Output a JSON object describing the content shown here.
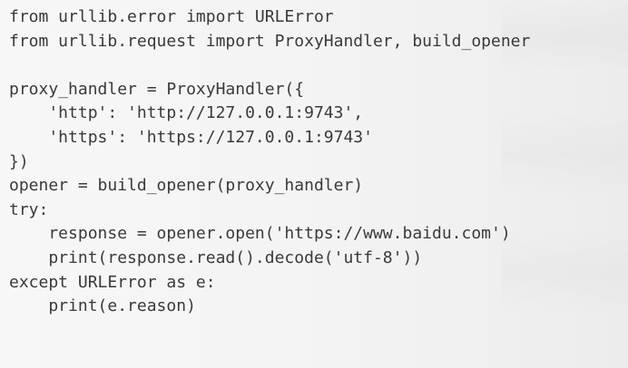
{
  "code": {
    "lines": [
      "from urllib.error import URLError",
      "from urllib.request import ProxyHandler, build_opener",
      "",
      "proxy_handler = ProxyHandler({",
      "    'http': 'http://127.0.0.1:9743',",
      "    'https': 'https://127.0.0.1:9743'",
      "})",
      "opener = build_opener(proxy_handler)",
      "try:",
      "    response = opener.open('https://www.baidu.com')",
      "    print(response.read().decode('utf-8'))",
      "except URLError as e:",
      "    print(e.reason)"
    ]
  }
}
